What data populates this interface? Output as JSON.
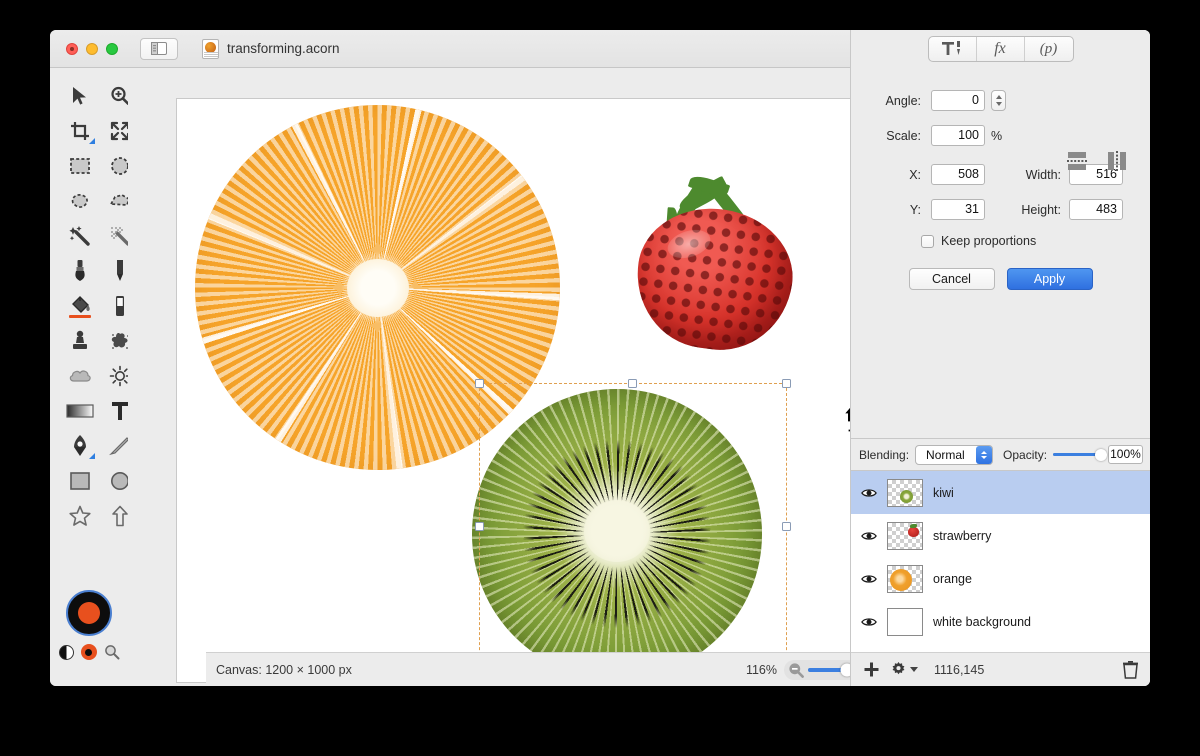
{
  "window": {
    "title": "transforming.acorn",
    "traffic_lights": [
      "close",
      "minimize",
      "zoom"
    ],
    "sidebar_toggle_icon": "sidebar-toggle-icon",
    "document_icon": "acorn-document-icon"
  },
  "tools": {
    "items": [
      {
        "name": "move-tool",
        "icon": "arrow-cursor-icon"
      },
      {
        "name": "zoom-tool",
        "icon": "magnifier-plus-icon"
      },
      {
        "name": "crop-tool",
        "icon": "crop-icon"
      },
      {
        "name": "transform-tool",
        "icon": "four-arrows-icon"
      },
      {
        "name": "rectangular-select-tool",
        "icon": "dashed-rectangle-icon"
      },
      {
        "name": "elliptical-select-tool",
        "icon": "dashed-ellipse-icon"
      },
      {
        "name": "lasso-tool",
        "icon": "lasso-icon"
      },
      {
        "name": "polygon-lasso-tool",
        "icon": "polygon-lasso-icon"
      },
      {
        "name": "magic-wand-tool",
        "icon": "magic-wand-icon"
      },
      {
        "name": "instant-alpha-tool",
        "icon": "dotted-wand-icon"
      },
      {
        "name": "brush-tool",
        "icon": "brush-icon"
      },
      {
        "name": "pencil-tool",
        "icon": "pencil-icon"
      },
      {
        "name": "paint-bucket-tool",
        "icon": "paint-bucket-icon"
      },
      {
        "name": "eraser-tool",
        "icon": "eraser-icon"
      },
      {
        "name": "clone-stamp-tool",
        "icon": "clone-stamp-icon"
      },
      {
        "name": "smudge-tool",
        "icon": "smudge-icon"
      },
      {
        "name": "blur-tool",
        "icon": "cloud-icon"
      },
      {
        "name": "dodge-tool",
        "icon": "sun-icon"
      },
      {
        "name": "gradient-tool",
        "icon": "gradient-icon"
      },
      {
        "name": "text-tool",
        "icon": "text-t-icon"
      },
      {
        "name": "pen-tool",
        "icon": "pen-nib-icon"
      },
      {
        "name": "line-tool",
        "icon": "line-icon"
      },
      {
        "name": "rectangle-shape-tool",
        "icon": "rectangle-icon"
      },
      {
        "name": "ellipse-shape-tool",
        "icon": "ellipse-icon"
      },
      {
        "name": "star-shape-tool",
        "icon": "star-icon"
      },
      {
        "name": "arrow-shape-tool",
        "icon": "arrow-up-icon"
      }
    ],
    "color_well": {
      "foreground": "#e8501e",
      "background": "#0d0d0d",
      "swap_icon": "swap-colors-icon",
      "reset_icon": "reset-colors-icon",
      "picker_icon": "color-picker-icon"
    }
  },
  "inspector": {
    "segments": [
      {
        "name": "tools-segment",
        "label": "",
        "icon": "hammer-tools-icon"
      },
      {
        "name": "filters-segment",
        "label": "fx",
        "icon": "fx-icon"
      },
      {
        "name": "palettes-segment",
        "label": "(p)",
        "icon": "palettes-icon"
      }
    ],
    "transform": {
      "angle_label": "Angle:",
      "angle_value": "0",
      "scale_label": "Scale:",
      "scale_value": "100",
      "scale_unit": "%",
      "x_label": "X:",
      "x_value": "508",
      "y_label": "Y:",
      "y_value": "31",
      "width_label": "Width:",
      "width_value": "516",
      "height_label": "Height:",
      "height_value": "483",
      "keep_proportions_label": "Keep proportions",
      "keep_proportions_checked": false,
      "flip_vertical_icon": "flip-vertical-icon",
      "flip_horizontal_icon": "flip-horizontal-icon",
      "cancel_label": "Cancel",
      "apply_label": "Apply"
    }
  },
  "layers": {
    "blending_label": "Blending:",
    "blending_value": "Normal",
    "opacity_label": "Opacity:",
    "opacity_value": "100%",
    "opacity_pct": 100,
    "items": [
      {
        "name": "kiwi",
        "visible": true,
        "selected": true,
        "thumb": "kiwi-thumbnail"
      },
      {
        "name": "strawberry",
        "visible": true,
        "selected": false,
        "thumb": "strawberry-thumbnail"
      },
      {
        "name": "orange",
        "visible": true,
        "selected": false,
        "thumb": "orange-thumbnail"
      },
      {
        "name": "white background",
        "visible": true,
        "selected": false,
        "thumb": "white-thumbnail"
      }
    ],
    "footer": {
      "add_icon": "plus-icon",
      "settings_icon": "gear-icon",
      "coordinates": "1116,145",
      "delete_icon": "trash-icon"
    }
  },
  "statusbar": {
    "canvas_size": "Canvas: 1200 × 1000 px",
    "zoom_level": "116%",
    "zoom_out_icon": "magnifier-minus-icon",
    "zoom_in_icon": "magnifier-plus-icon",
    "zoom_slider_pct": 48
  },
  "canvas": {
    "artwork": [
      "orange-slice",
      "strawberry",
      "kiwi-slice"
    ],
    "selection_tool_cursor": "move-cursor-icon",
    "selection_handles": 8,
    "selection_color": "#e0a050"
  }
}
